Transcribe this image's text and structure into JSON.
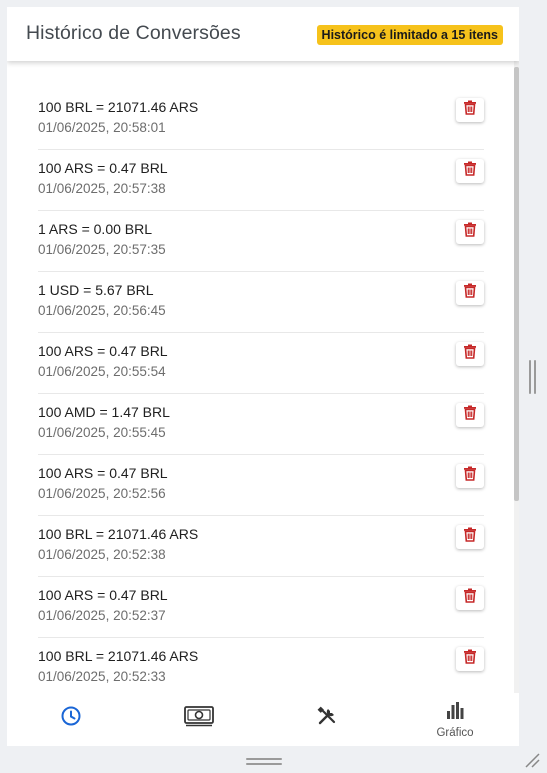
{
  "header": {
    "title": "Histórico de Conversões",
    "limit_badge": "Histórico é limitado a 15 itens"
  },
  "history": [
    {
      "conversion": "100 BRL = 21071.46 ARS",
      "timestamp": "01/06/2025, 20:58:01"
    },
    {
      "conversion": "100 ARS = 0.47 BRL",
      "timestamp": "01/06/2025, 20:57:38"
    },
    {
      "conversion": "1 ARS = 0.00 BRL",
      "timestamp": "01/06/2025, 20:57:35"
    },
    {
      "conversion": "1 USD = 5.67 BRL",
      "timestamp": "01/06/2025, 20:56:45"
    },
    {
      "conversion": "100 ARS = 0.47 BRL",
      "timestamp": "01/06/2025, 20:55:54"
    },
    {
      "conversion": "100 AMD = 1.47 BRL",
      "timestamp": "01/06/2025, 20:55:45"
    },
    {
      "conversion": "100 ARS = 0.47 BRL",
      "timestamp": "01/06/2025, 20:52:56"
    },
    {
      "conversion": "100 BRL = 21071.46 ARS",
      "timestamp": "01/06/2025, 20:52:38"
    },
    {
      "conversion": "100 ARS = 0.47 BRL",
      "timestamp": "01/06/2025, 20:52:37"
    },
    {
      "conversion": "100 BRL = 21071.46 ARS",
      "timestamp": "01/06/2025, 20:52:33"
    }
  ],
  "delete_icon": "trash-icon",
  "nav": {
    "items": [
      {
        "icon": "clock-icon",
        "label": "",
        "active": true
      },
      {
        "icon": "money-icon",
        "label": ""
      },
      {
        "icon": "tools-icon",
        "label": ""
      },
      {
        "icon": "bar-chart-icon",
        "label": "Gráfico"
      }
    ]
  },
  "colors": {
    "accent": "#1a66d6",
    "badge": "#f6c21b",
    "delete": "#c62828"
  }
}
